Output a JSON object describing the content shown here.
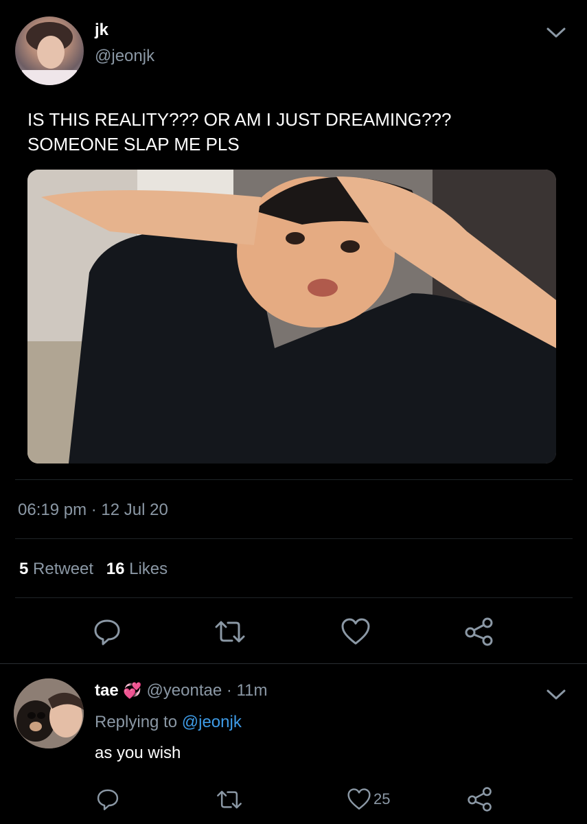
{
  "tweet": {
    "display_name": "jk",
    "handle": "@jeonjk",
    "text_line1": "IS THIS REALITY??? OR AM I JUST DREAMING???",
    "text_line2": "SOMEONE SLAP ME PLS",
    "time": "06:19 pm",
    "date_sep": "·",
    "date": "12 Jul 20",
    "retweet_count": "5",
    "retweet_label": "Retweet",
    "like_count": "16",
    "like_label": "Likes"
  },
  "reply": {
    "display_name": "tae",
    "emoji": "💞",
    "handle": "@yeontae",
    "time": "· 11m",
    "replying_label": "Replying to",
    "replying_handle": "@jeonjk",
    "text": "as you wish",
    "like_count": "25"
  },
  "icons": [
    "chevron-down-icon",
    "reply-icon",
    "retweet-icon",
    "like-icon",
    "share-icon"
  ],
  "colors": {
    "background": "#000000",
    "text": "#ffffff",
    "muted": "#8b98a5",
    "link": "#3e9be6",
    "divider": "#1f2428"
  }
}
